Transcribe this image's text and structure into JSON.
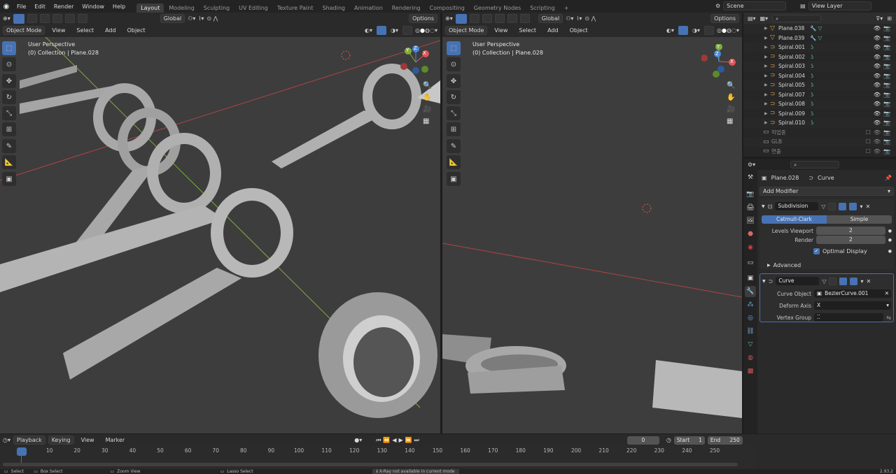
{
  "topbar": {
    "menus": [
      "File",
      "Edit",
      "Render",
      "Window",
      "Help"
    ],
    "workspaces": [
      "Layout",
      "Modeling",
      "Sculpting",
      "UV Editing",
      "Texture Paint",
      "Shading",
      "Animation",
      "Rendering",
      "Compositing",
      "Geometry Nodes",
      "Scripting"
    ],
    "active_workspace": "Layout",
    "add_tab": "+",
    "scene": "Scene",
    "view_layer": "View Layer"
  },
  "left_viewport": {
    "transform_orientation": "Global",
    "options": "Options",
    "mode": "Object Mode",
    "menus": [
      "View",
      "Select",
      "Add",
      "Object"
    ],
    "perspective": "User Perspective",
    "collection": "(0) Collection | Plane.028"
  },
  "right_viewport": {
    "transform_orientation": "Global",
    "options": "Options",
    "mode": "Object Mode",
    "menus": [
      "View",
      "Select",
      "Add",
      "Object"
    ],
    "perspective": "User Perspective",
    "collection": "(0) Collection | Plane.028"
  },
  "gizmo": {
    "x": "X",
    "y": "Y",
    "z": "Z"
  },
  "outliner": {
    "items": [
      {
        "name": "Plane.038",
        "type": "mesh"
      },
      {
        "name": "Plane.039",
        "type": "mesh"
      },
      {
        "name": "Spiral.001",
        "type": "curve"
      },
      {
        "name": "Spiral.002",
        "type": "curve"
      },
      {
        "name": "Spiral.003",
        "type": "curve"
      },
      {
        "name": "Spiral.004",
        "type": "curve"
      },
      {
        "name": "Spiral.005",
        "type": "curve"
      },
      {
        "name": "Spiral.007",
        "type": "curve"
      },
      {
        "name": "Spiral.008",
        "type": "curve"
      },
      {
        "name": "Spiral.009",
        "type": "curve"
      },
      {
        "name": "Spiral.010",
        "type": "curve"
      }
    ],
    "collections": [
      "작업중",
      "GLB",
      "연출"
    ]
  },
  "properties": {
    "object_name": "Plane.028",
    "data_name": "Curve",
    "add_modifier": "Add Modifier",
    "subdivision": {
      "name": "Subdivision",
      "mode_a": "Catmull-Clark",
      "mode_b": "Simple",
      "levels_viewport_label": "Levels Viewport",
      "levels_viewport": "2",
      "render_label": "Render",
      "render": "2",
      "optimal_display": "Optimal Display",
      "advanced": "Advanced"
    },
    "curve": {
      "name": "Curve",
      "curve_object_label": "Curve Object",
      "curve_object": "BezierCurve.001",
      "deform_axis_label": "Deform Axis",
      "deform_axis": "X",
      "vertex_group_label": "Vertex Group"
    }
  },
  "timeline": {
    "menus": [
      "Playback",
      "Keying",
      "View",
      "Marker"
    ],
    "current_frame": "0",
    "start_label": "Start",
    "start": "1",
    "end_label": "End",
    "end": "250",
    "ticks": [
      "0",
      "10",
      "20",
      "30",
      "40",
      "50",
      "60",
      "70",
      "80",
      "90",
      "100",
      "110",
      "120",
      "130",
      "140",
      "150",
      "160",
      "170",
      "180",
      "190",
      "200",
      "210",
      "220",
      "230",
      "240",
      "250"
    ]
  },
  "statusbar": {
    "select": "Select",
    "box_select": "Box Select",
    "zoom_view": "Zoom View",
    "lasso_select": "Lasso Select",
    "xray_msg": "X-Ray not available in current mode",
    "version": "2.93.2"
  }
}
